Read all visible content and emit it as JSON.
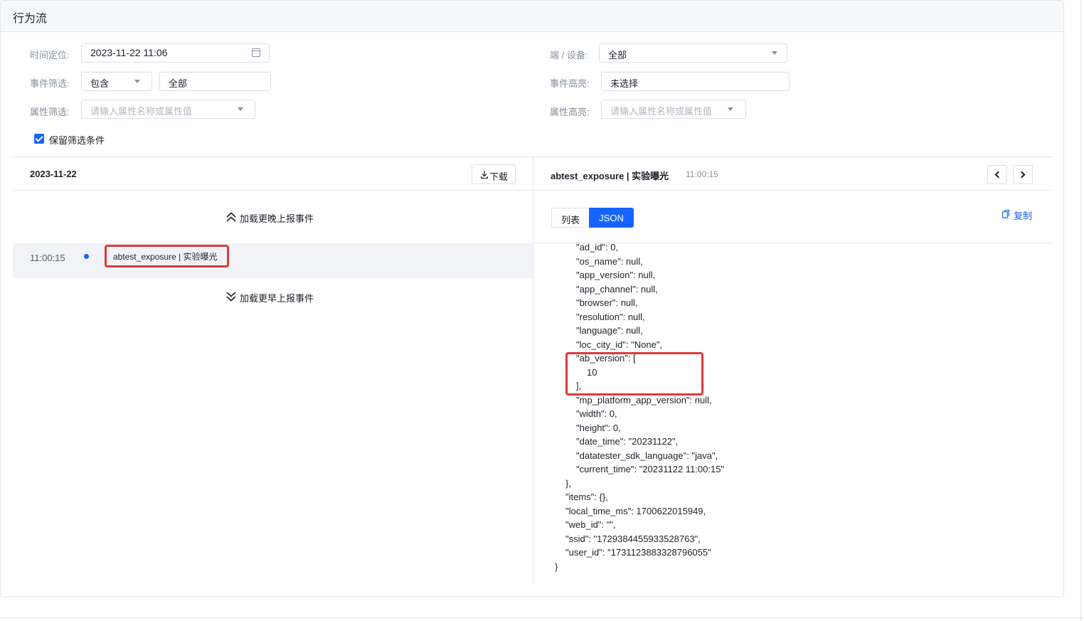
{
  "page": {
    "title": "行为流"
  },
  "filters": {
    "time_label": "时间定位:",
    "time_value": "2023-11-22 11:06",
    "device_label": "端 / 设备:",
    "device_value": "全部",
    "event_filter_label": "事件筛选:",
    "event_filter_mode": "包含",
    "event_filter_value": "全部",
    "event_highlight_label": "事件高亮:",
    "event_highlight_value": "未选择",
    "attr_filter_label": "属性筛选:",
    "attr_filter_placeholder": "请输入属性名称或属性值",
    "attr_highlight_label": "属性高亮:",
    "attr_highlight_placeholder": "请输入属性名称或属性值",
    "keep_filters_label": "保留筛选条件",
    "keep_filters_checked": true
  },
  "timeline": {
    "date": "2023-11-22",
    "download_label": "下载",
    "load_later": "加载更晚上报事件",
    "load_earlier": "加载更早上报事件",
    "events": [
      {
        "time": "11:00:15",
        "name": "abtest_exposure | 实验曝光"
      }
    ]
  },
  "detail": {
    "title": "abtest_exposure | 实验曝光",
    "time": "11:00:15",
    "tab_list": "列表",
    "tab_json": "JSON",
    "active_tab": "JSON",
    "copy_label": "复制",
    "json_lines": [
      "\"ad_id\": 0,",
      "\"os_name\": null,",
      "\"app_version\": null,",
      "\"app_channel\": null,",
      "\"browser\": null,",
      "\"resolution\": null,",
      "\"language\": null,",
      "\"loc_city_id\": \"None\",",
      "\"ab_version\": [",
      "10",
      "],",
      "\"mp_platform_app_version\": null,",
      "\"width\": 0,",
      "\"height\": 0,",
      "\"date_time\": \"20231122\",",
      "\"datatester_sdk_language\": \"java\",",
      "\"current_time\": \"20231122 11:00:15\"",
      "},",
      "\"items\": {},",
      "\"local_time_ms\": 1700622015949,",
      "\"web_id\": \"\",",
      "\"ssid\": \"1729384455933528763\",",
      "\"user_id\": \"1731123883328796055\"",
      "}"
    ]
  },
  "colors": {
    "accent": "#1664ff",
    "highlight": "#e03a3a"
  }
}
